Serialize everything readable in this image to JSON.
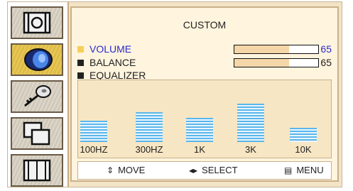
{
  "menu": {
    "title": "CUSTOM",
    "volume": {
      "label": "VOLUME",
      "value": "65",
      "level": 0.65
    },
    "balance": {
      "label": "BALANCE",
      "value": "65",
      "level": 0.65
    },
    "equalizer": {
      "label": "EQUALIZER",
      "bands": [
        {
          "label": "100HZ",
          "level": 0.38
        },
        {
          "label": "300HZ",
          "level": 0.52
        },
        {
          "label": "1K",
          "level": 0.42
        },
        {
          "label": "3K",
          "level": 0.68
        },
        {
          "label": "10K",
          "level": 0.25
        }
      ]
    }
  },
  "sidebar": {
    "items": [
      {
        "icon": "picture-icon"
      },
      {
        "icon": "speaker-icon",
        "active": true
      },
      {
        "icon": "key-icon"
      },
      {
        "icon": "pip-icon"
      },
      {
        "icon": "screen-icon"
      }
    ]
  },
  "footer": {
    "move_label": "MOVE",
    "select_label": "SELECT",
    "menu_label": "MENU"
  },
  "colors": {
    "selected_text": "#2a2ad0",
    "bar_fill": "#f5d6a8",
    "eq_bar": "#5ab6ea",
    "active_tile": "#e6c34a"
  }
}
